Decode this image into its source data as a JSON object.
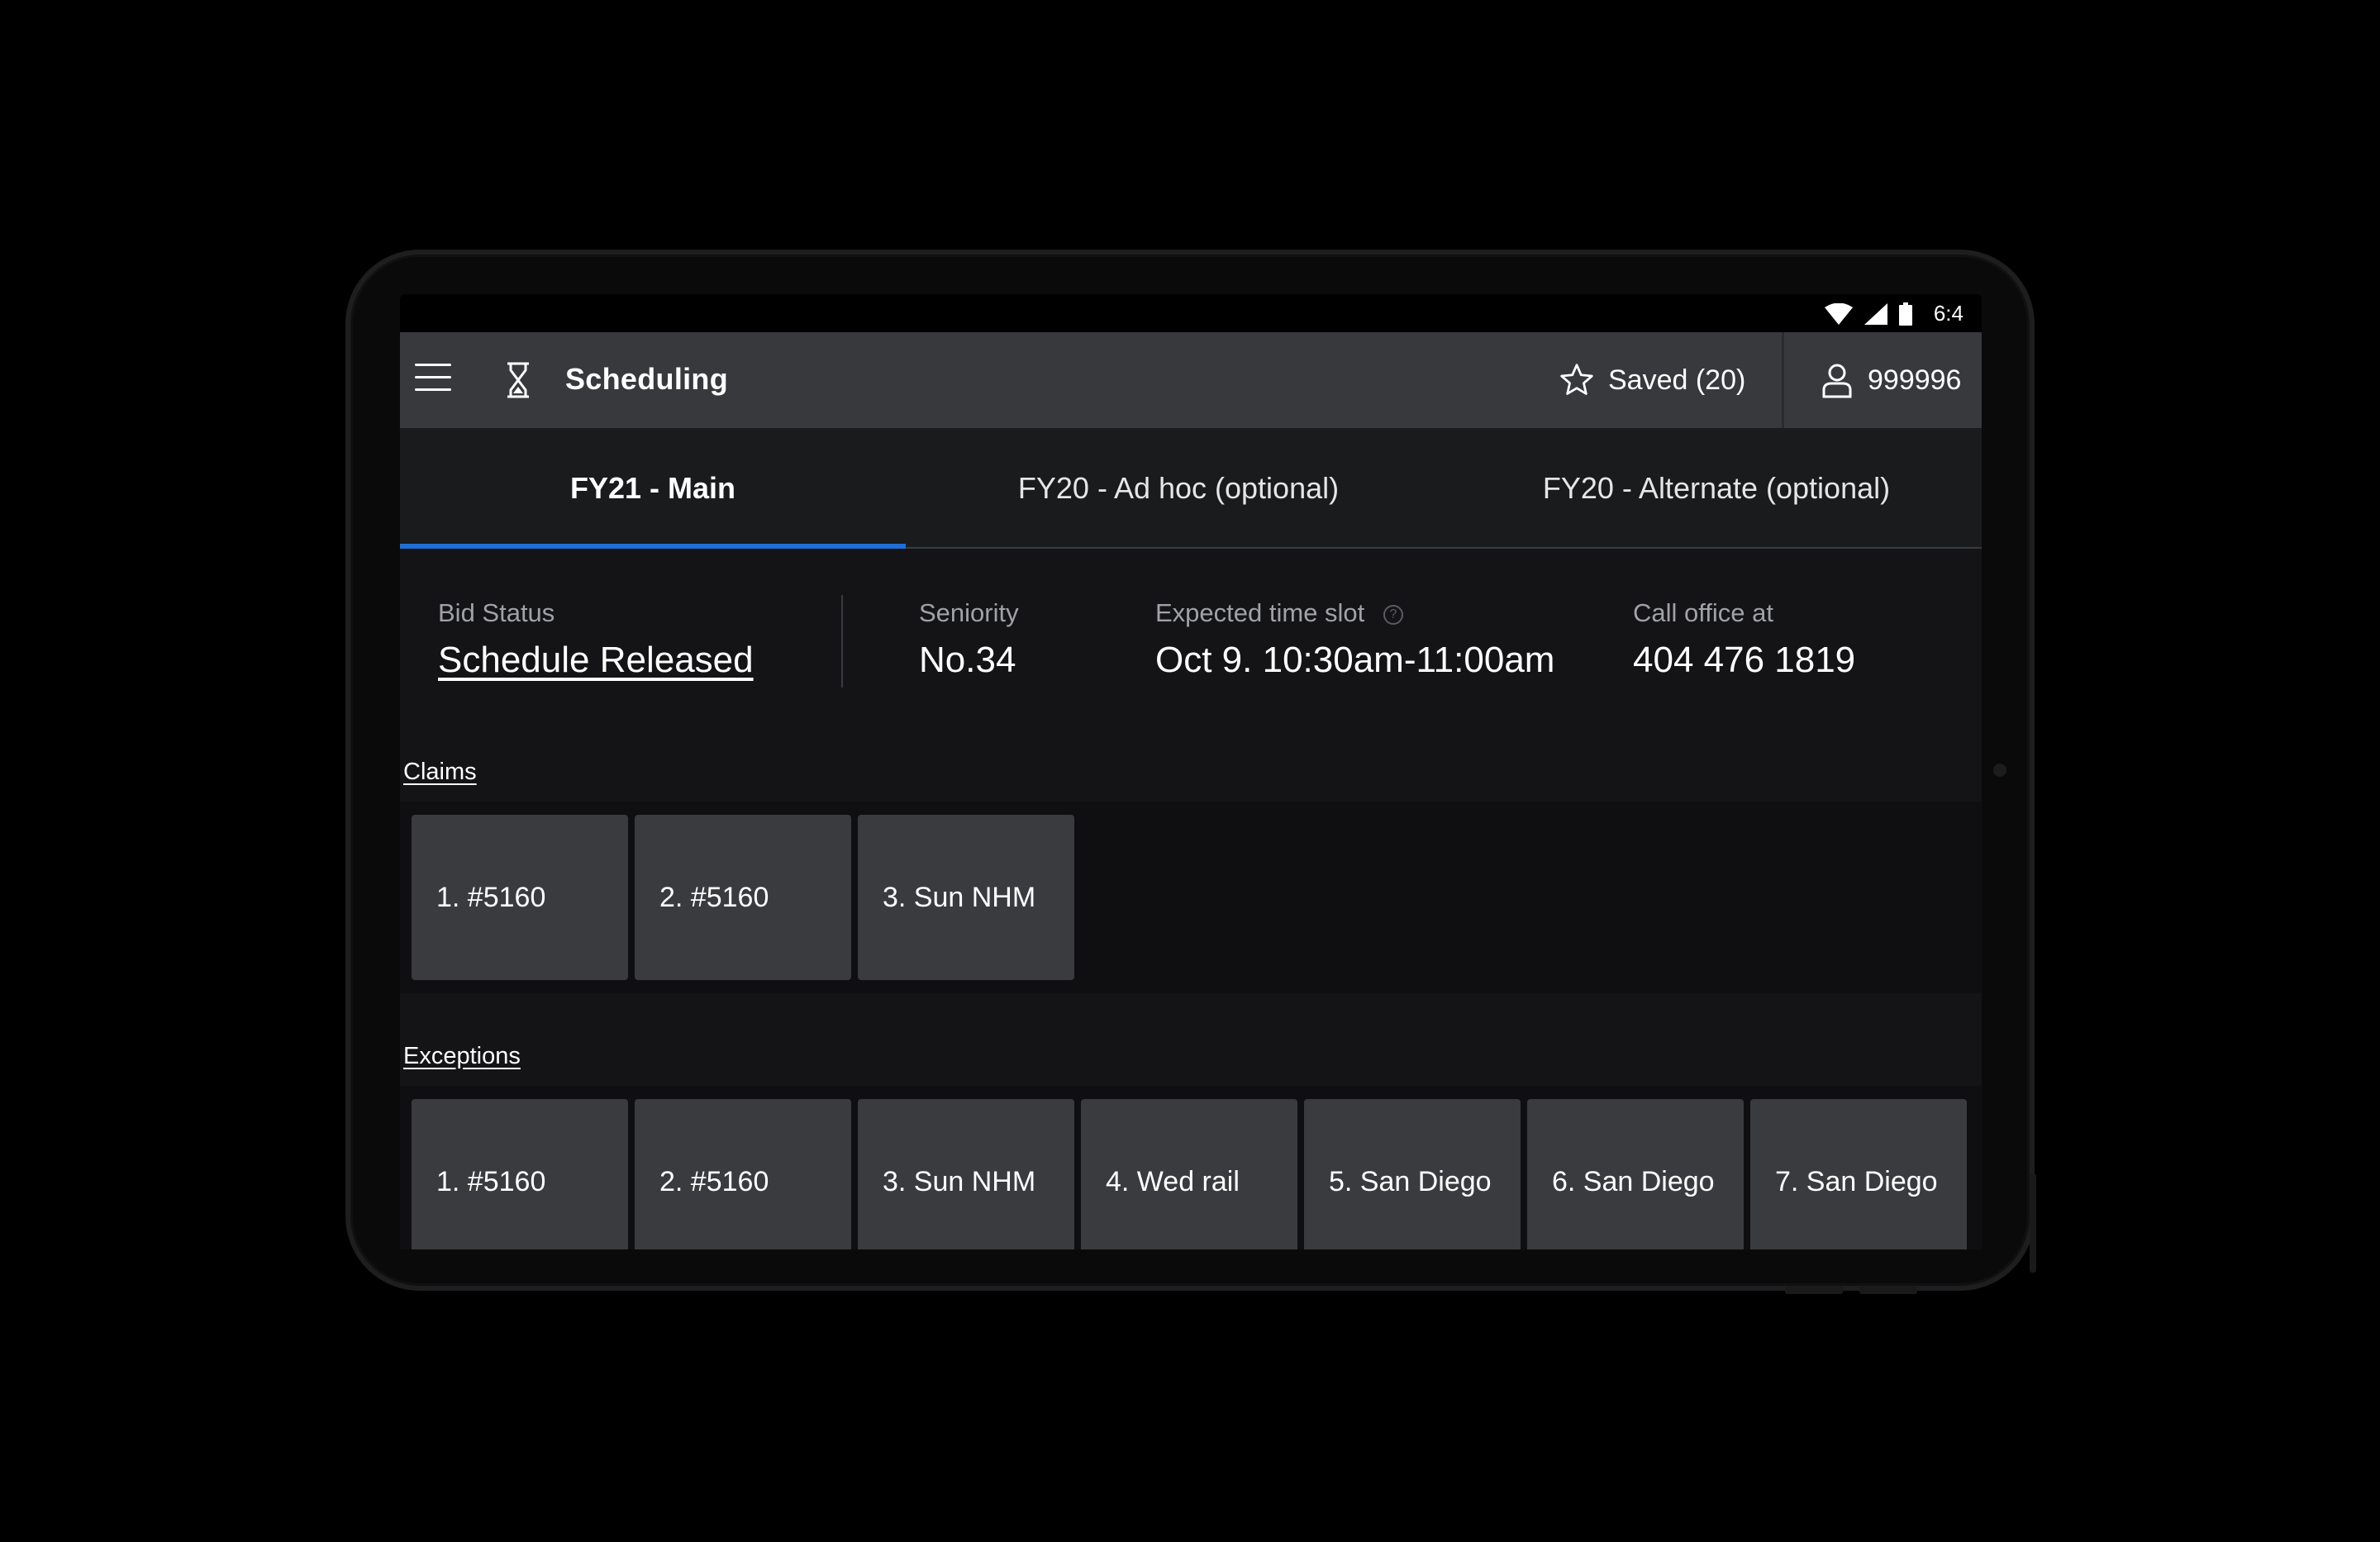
{
  "status_bar": {
    "time": "6:4"
  },
  "app_bar": {
    "title": "Scheduling",
    "saved_label": "Saved (20)",
    "user_id": "999996"
  },
  "tabs": [
    {
      "label": "FY21 - Main",
      "active": true
    },
    {
      "label": "FY20 - Ad hoc (optional)",
      "active": false
    },
    {
      "label": "FY20 - Alternate (optional)",
      "active": false
    }
  ],
  "info": {
    "bid_status": {
      "label": "Bid Status",
      "value": "Schedule Released"
    },
    "seniority": {
      "label": "Seniority",
      "value": "No.34"
    },
    "time_slot": {
      "label": "Expected time slot",
      "value": "Oct 9. 10:30am-11:00am"
    },
    "call_office": {
      "label": "Call office at",
      "value": "404 476 1819"
    }
  },
  "claims": {
    "label": "Claims",
    "items": [
      "1. #5160",
      "2. #5160",
      "3. Sun NHM"
    ]
  },
  "exceptions": {
    "label": "Exceptions",
    "items": [
      "1. #5160",
      "2. #5160",
      "3. Sun NHM",
      "4. Wed rail",
      "5. San Diego",
      "6. San Diego",
      "7. San Diego"
    ]
  },
  "colors": {
    "app_bar": "#38393d",
    "tab_indicator": "#1f6fd6",
    "chip": "#3a3b3f"
  }
}
